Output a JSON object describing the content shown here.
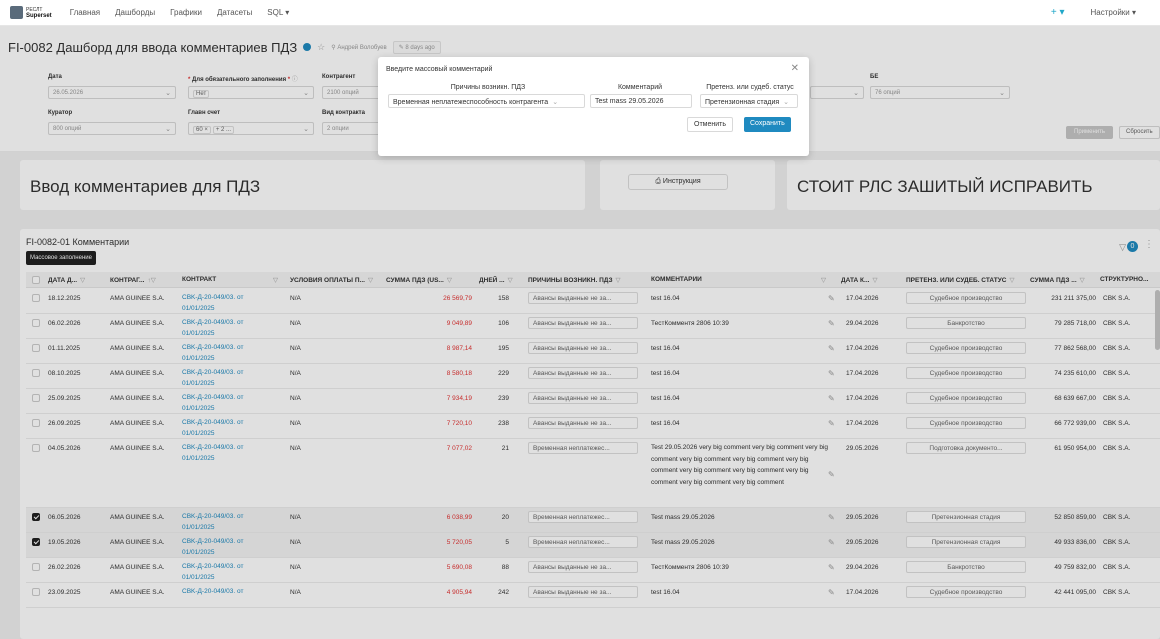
{
  "nav": {
    "logo_top": "РЕСЛТ",
    "logo_bottom": "Superset",
    "items": [
      "Главная",
      "Дашборды",
      "Графики",
      "Датасеты",
      "SQL ▾"
    ],
    "plus": "+ ▾",
    "settings": "Настройки ▾"
  },
  "header": {
    "title": "FI-0082 Дашборд для ввода комментариев ПДЗ",
    "owner": "Андрей Волобуев",
    "modified": "8 days ago"
  },
  "filters": {
    "date_label": "Дата",
    "date_value": "26.05.2026",
    "mandatory_label": "Для обязательного заполнения",
    "mandatory_value": "Нет",
    "counterparty_label": "Контрагент",
    "counterparty_value": "2100 опций",
    "curator_label": "Куратор",
    "curator_value": "800 опций",
    "account_label": "Главн счет",
    "account_tag1": "60 ×",
    "account_tag2": "+ 2 ...",
    "contract_label": "Вид контракта",
    "contract_value": "2 опции",
    "be_label": "БЕ",
    "be_value": "76 опций",
    "apply": "Применить",
    "reset": "Сбросить"
  },
  "cards": {
    "left_title": "Ввод комментариев для ПДЗ",
    "instruction_button": "Инструкция",
    "right_title": "СТОИТ РЛС ЗАШИТЫЙ ИСПРАВИТЬ"
  },
  "table": {
    "title": "FI-0082-01 Комментарии",
    "mass_button": "Массовое заполнение",
    "filter_count": "0",
    "headers": [
      "ДАТА Д...",
      "КОНТРАГ...",
      "КОНТРАКТ",
      "УСЛОВИЯ ОПЛАТЫ П...",
      "СУММА ПДЗ (US...",
      "ДНЕЙ ...",
      "ПРИЧИНЫ ВОЗНИКН. ПДЗ",
      "КОММЕНТАРИЙ",
      "ДАТА К...",
      "ПРЕТЕНЗ. ИЛИ СУДЕБ. СТАТУС",
      "СУММА ПДЗ ...",
      "СТРУКТУРНО..."
    ],
    "rows": [
      {
        "date": "18.12.2025",
        "cp": "AMA GUINEE S.A.",
        "contract1": "CBK-Д-20-049/03. от",
        "contract2": "01/01/2025",
        "terms": "N/A",
        "sum": "26 569,79",
        "days": "158",
        "reason": "Авансы выданные не за...",
        "comment": "test 16.04",
        "cdate": "17.04.2026",
        "status": "Судебное производство",
        "sum2": "231 211 375,00",
        "struct": "CBK S.A.",
        "checked": false
      },
      {
        "date": "06.02.2026",
        "cp": "AMA GUINEE S.A.",
        "contract1": "CBK-Д-20-049/03. от",
        "contract2": "01/01/2025",
        "terms": "N/A",
        "sum": "9 049,89",
        "days": "106",
        "reason": "Авансы выданные не за...",
        "comment": "ТестКомментя 2806 10:39",
        "cdate": "29.04.2026",
        "status": "Банкротство",
        "sum2": "79 285 718,00",
        "struct": "CBK S.A.",
        "checked": false
      },
      {
        "date": "01.11.2025",
        "cp": "AMA GUINEE S.A.",
        "contract1": "CBK-Д-20-049/03. от",
        "contract2": "01/01/2025",
        "terms": "N/A",
        "sum": "8 987,14",
        "days": "195",
        "reason": "Авансы выданные не за...",
        "comment": "test 16.04",
        "cdate": "17.04.2026",
        "status": "Судебное производство",
        "sum2": "77 862 568,00",
        "struct": "CBK S.A.",
        "checked": false
      },
      {
        "date": "08.10.2025",
        "cp": "AMA GUINEE S.A.",
        "contract1": "CBK-Д-20-049/03. от",
        "contract2": "01/01/2025",
        "terms": "N/A",
        "sum": "8 580,18",
        "days": "229",
        "reason": "Авансы выданные не за...",
        "comment": "test 16.04",
        "cdate": "17.04.2026",
        "status": "Судебное производство",
        "sum2": "74 235 610,00",
        "struct": "CBK S.A.",
        "checked": false
      },
      {
        "date": "25.09.2025",
        "cp": "AMA GUINEE S.A.",
        "contract1": "CBK-Д-20-049/03. от",
        "contract2": "01/01/2025",
        "terms": "N/A",
        "sum": "7 934,19",
        "days": "239",
        "reason": "Авансы выданные не за...",
        "comment": "test 16.04",
        "cdate": "17.04.2026",
        "status": "Судебное производство",
        "sum2": "68 639 667,00",
        "struct": "CBK S.A.",
        "checked": false
      },
      {
        "date": "26.09.2025",
        "cp": "AMA GUINEE S.A.",
        "contract1": "CBK-Д-20-049/03. от",
        "contract2": "01/01/2025",
        "terms": "N/A",
        "sum": "7 720,10",
        "days": "238",
        "reason": "Авансы выданные не за...",
        "comment": "test 16.04",
        "cdate": "17.04.2026",
        "status": "Судебное производство",
        "sum2": "66 772 939,00",
        "struct": "CBK S.A.",
        "checked": false
      },
      {
        "date": "04.05.2026",
        "cp": "AMA GUINEE S.A.",
        "contract1": "CBK-Д-20-049/03. от",
        "contract2": "01/01/2025",
        "terms": "N/A",
        "sum": "7 077,02",
        "days": "21",
        "reason": "Временная неплатежес...",
        "comment": "Test 29.05.2026 very big comment very big comment very big comment very big comment very big comment very big comment very big comment very big comment very big comment very big comment very big comment",
        "cdate": "29.05.2026",
        "status": "Подготовка документо...",
        "sum2": "61 950 954,00",
        "struct": "CBK S.A.",
        "checked": false
      },
      {
        "date": "06.05.2026",
        "cp": "AMA GUINEE S.A.",
        "contract1": "CBK-Д-20-049/03. от",
        "contract2": "01/01/2025",
        "terms": "N/A",
        "sum": "6 038,99",
        "days": "20",
        "reason": "Временная неплатежес...",
        "comment": "Test mass 29.05.2026",
        "cdate": "29.05.2026",
        "status": "Претензионная стадия",
        "sum2": "52 850 859,00",
        "struct": "CBK S.A.",
        "checked": true
      },
      {
        "date": "19.05.2026",
        "cp": "AMA GUINEE S.A.",
        "contract1": "CBK-Д-20-049/03. от",
        "contract2": "01/01/2025",
        "terms": "N/A",
        "sum": "5 720,05",
        "days": "5",
        "reason": "Временная неплатежес...",
        "comment": "Test mass 29.05.2026",
        "cdate": "29.05.2026",
        "status": "Претензионная стадия",
        "sum2": "49 933 836,00",
        "struct": "CBK S.A.",
        "checked": true
      },
      {
        "date": "26.02.2026",
        "cp": "AMA GUINEE S.A.",
        "contract1": "CBK-Д-20-049/03. от",
        "contract2": "01/01/2025",
        "terms": "N/A",
        "sum": "5 690,08",
        "days": "88",
        "reason": "Авансы выданные не за...",
        "comment": "ТестКомментя 2806 10:39",
        "cdate": "29.04.2026",
        "status": "Банкротство",
        "sum2": "49 759 832,00",
        "struct": "CBK S.A.",
        "checked": false
      },
      {
        "date": "23.09.2025",
        "cp": "AMA GUINEE S.A.",
        "contract1": "CBK-Д-20-049/03. от",
        "contract2": "",
        "terms": "N/A",
        "sum": "4 905,94",
        "days": "242",
        "reason": "Авансы выданные не за...",
        "comment": "test 16.04",
        "cdate": "17.04.2026",
        "status": "Судебное производство",
        "sum2": "42 441 095,00",
        "struct": "CBK S.A.",
        "checked": false
      }
    ]
  },
  "modal": {
    "title": "Введите массовый комментарий",
    "reason_label": "Причины возникн. ПДЗ",
    "reason_value": "Временная неплатежеспособность контрагента",
    "comment_label": "Комментарий",
    "comment_value": "Test mass 29.05.2026",
    "status_label": "Претенз. или судеб. статус",
    "status_value": "Претензионная стадия",
    "cancel": "Отменить",
    "save": "Сохранить"
  },
  "colors": {
    "accent": "#1f8ac0",
    "negative": "#e23333"
  }
}
